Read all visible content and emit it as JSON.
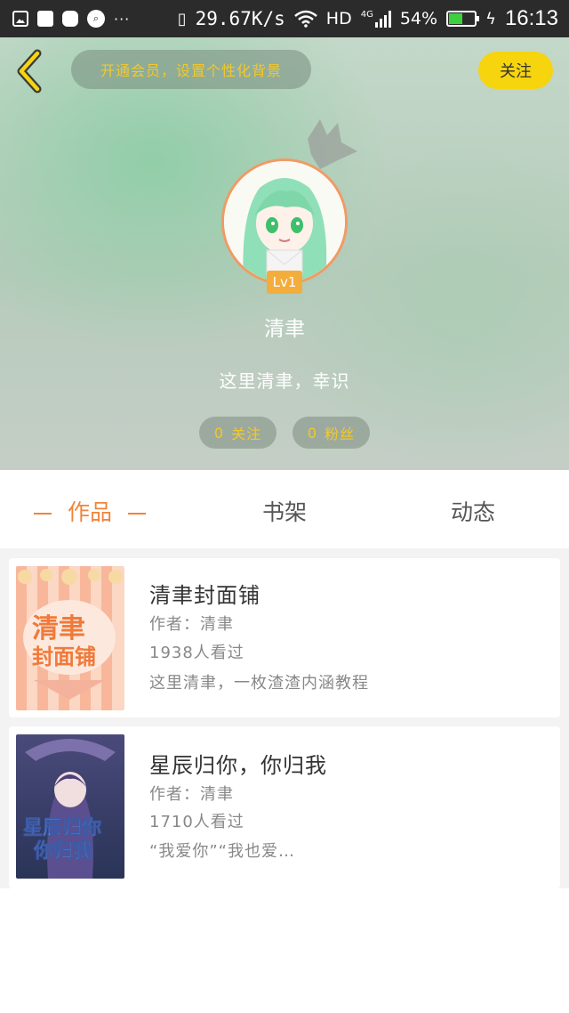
{
  "status_bar": {
    "net_speed": "29.67K/s",
    "network": "HD",
    "network_gen": "4G",
    "battery": "54%",
    "battery_level": 0.54,
    "time": "16:13",
    "dots": "···"
  },
  "header": {
    "vip_banner": "开通会员，设置个性化背景",
    "follow_label": "关注",
    "level": "Lv1",
    "username": "清聿",
    "bio": "这里清聿，幸识",
    "following_count": "0",
    "following_label": "关注",
    "fans_count": "0",
    "fans_label": "粉丝",
    "colors": {
      "accent_yellow": "#f6d40e",
      "avatar_ring": "#f29a64",
      "badge": "#f3ad3c"
    }
  },
  "tabs": [
    {
      "label": "作品",
      "active": true
    },
    {
      "label": "书架",
      "active": false
    },
    {
      "label": "动态",
      "active": false
    }
  ],
  "books": [
    {
      "title": "清聿封面铺",
      "author": "作者：清聿",
      "views": "1938人看过",
      "desc": "这里清聿，一枚渣渣内涵教程",
      "cover_icon": "cover-art-pink"
    },
    {
      "title": "星辰归你，你归我",
      "author": "作者：清聿",
      "views": "1710人看过",
      "desc": "“我爱你”“我也爱…",
      "cover_icon": "cover-art-anime-girl"
    }
  ]
}
